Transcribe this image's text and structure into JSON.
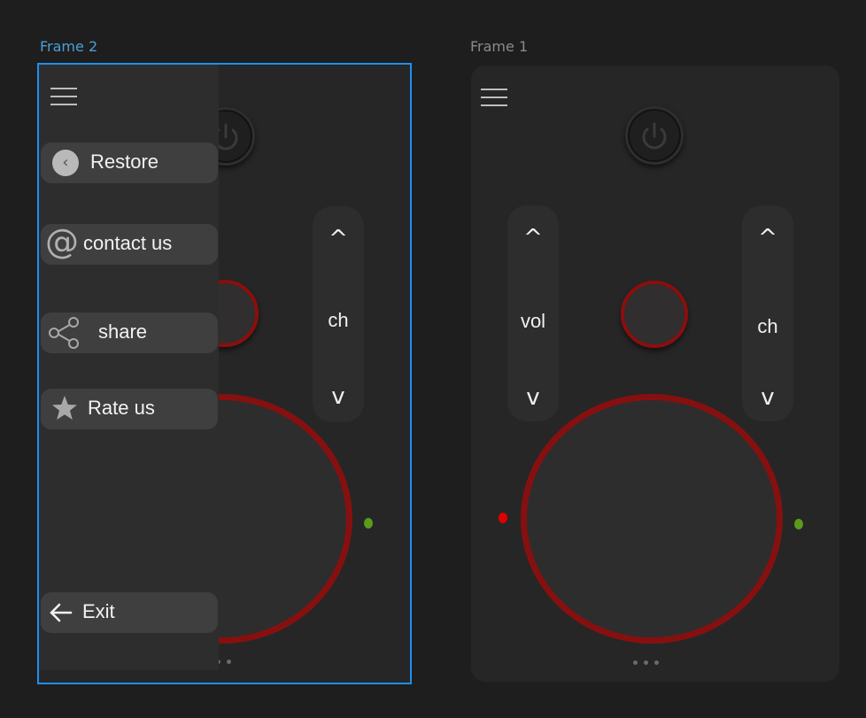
{
  "canvas": {
    "frames": [
      {
        "label": "Frame 2",
        "selected": true,
        "remote": {
          "rockers": [
            {
              "up": "^",
              "label": "ch",
              "down": "v"
            }
          ],
          "pager_dots": 2
        },
        "drawer": {
          "items": [
            {
              "label": "Restore",
              "icon": "back-circle-icon"
            },
            {
              "label": "contact us",
              "icon": "at-sign-icon"
            },
            {
              "label": "share",
              "icon": "share-icon"
            },
            {
              "label": "Rate us",
              "icon": "star-icon"
            },
            {
              "label": "Exit",
              "icon": "arrow-left-icon"
            }
          ]
        }
      },
      {
        "label": "Frame 1",
        "selected": false,
        "remote": {
          "rockers": [
            {
              "up": "^",
              "label": "vol",
              "down": "v"
            },
            {
              "up": "^",
              "label": "ch",
              "down": "v"
            }
          ],
          "pager_dots": 3
        }
      }
    ]
  },
  "colors": {
    "background": "#1e1e1e",
    "frame": "#262626",
    "selection": "#1f8ff0",
    "accent_red": "#861010",
    "led_red": "#e00000",
    "led_green": "#5a9b1a"
  }
}
